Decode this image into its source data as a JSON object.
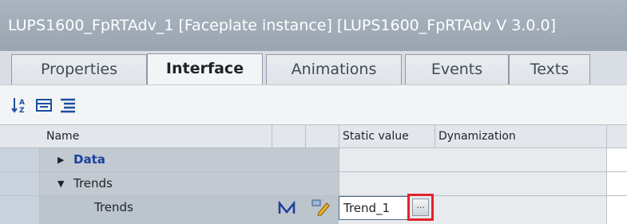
{
  "window": {
    "title": "LUPS1600_FpRTAdv_1 [Faceplate instance] [LUPS1600_FpRTAdv V 3.0.0]"
  },
  "tabs": [
    {
      "label": "Properties",
      "active": false
    },
    {
      "label": "Interface",
      "active": true
    },
    {
      "label": "Animations",
      "active": false
    },
    {
      "label": "Events",
      "active": false
    },
    {
      "label": "Texts",
      "active": false
    }
  ],
  "toolbar": {
    "icons": [
      "sort-az-icon",
      "collapse-all-icon",
      "expand-all-icon"
    ]
  },
  "grid": {
    "columns": {
      "name": "Name",
      "static_value": "Static value",
      "dynamization": "Dynamization"
    },
    "rows": [
      {
        "label": "Data",
        "expander": "collapsed",
        "level": 1,
        "color": "#1c3f9e"
      },
      {
        "label": "Trends",
        "expander": "expanded",
        "level": 1,
        "color": "#1f2428"
      },
      {
        "label": "Trends",
        "expander": "none",
        "level": 2,
        "static_value": "Trend_1",
        "ellipsis": "..."
      }
    ]
  },
  "colors": {
    "highlight": "#e2232b",
    "link": "#1c3f9e"
  }
}
